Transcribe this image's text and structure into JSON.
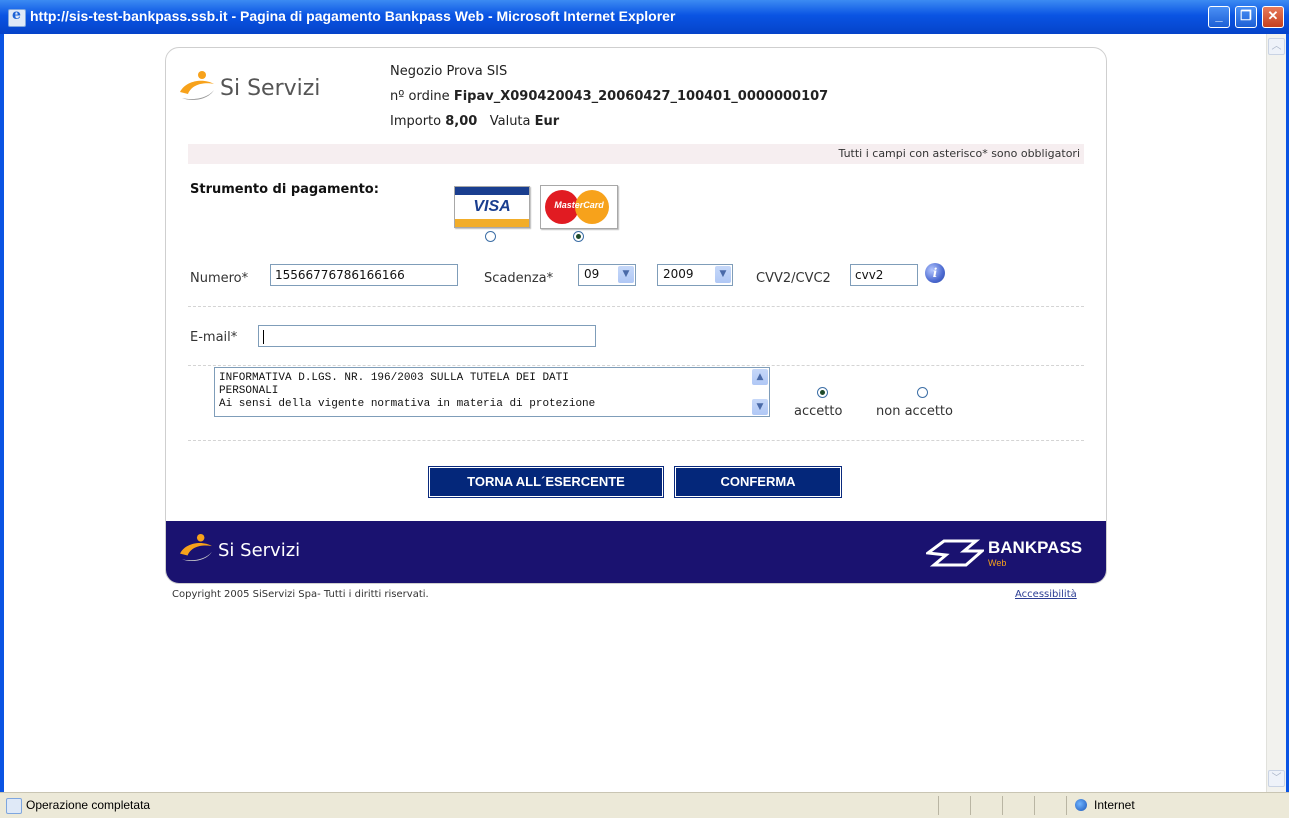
{
  "window": {
    "title": "http://sis-test-bankpass.ssb.it - Pagina di pagamento Bankpass Web - Microsoft Internet Explorer",
    "minimize": "_",
    "restore": "❐",
    "close": "✕"
  },
  "header": {
    "brand": "Si Servizi",
    "shop": "Negozio Prova SIS",
    "order_label": "nº ordine",
    "order_value": "Fipav_X090420043_20060427_100401_0000000107",
    "amount_label": "Importo",
    "amount_value": "8,00",
    "currency_label": "Valuta",
    "currency_value": "Eur"
  },
  "notice": "Tutti i campi con asterisco* sono obbligatori",
  "payment": {
    "label": "Strumento di pagamento:",
    "cards": [
      {
        "name": "VISA",
        "selected": false
      },
      {
        "name": "MasterCard",
        "selected": true
      }
    ]
  },
  "form": {
    "number_label": "Numero*",
    "number_value": "15566776786166166",
    "expiry_label": "Scadenza*",
    "expiry_month": "09",
    "expiry_year": "2009",
    "cvv_label": "CVV2/CVC2",
    "cvv_value": "cvv2",
    "email_label": "E-mail*",
    "email_value": ""
  },
  "privacy": {
    "text": "INFORMATIVA D.LGS. NR. 196/2003 SULLA TUTELA DEI DATI\nPERSONALI\nAi sensi della vigente normativa in materia di protezione",
    "accept_label": "accetto",
    "reject_label": "non accetto",
    "accepted": true
  },
  "buttons": {
    "back": "TORNA ALL´ESERCENTE",
    "confirm": "CONFERMA"
  },
  "footer": {
    "brand": "Si Servizi",
    "bankpass": "BANKPASS",
    "bankpass_sub": "Web",
    "copyright": "Copyright 2005 SiServizi Spa- Tutti i diritti riservati.",
    "accessibility": "Accessibilità"
  },
  "status": {
    "text": "Operazione completata",
    "zone": "Internet"
  },
  "colors": {
    "title_bar": "#0a54e3",
    "footer_band": "#1a1270",
    "button": "#04277a",
    "brand_orange": "#f7a21b"
  }
}
